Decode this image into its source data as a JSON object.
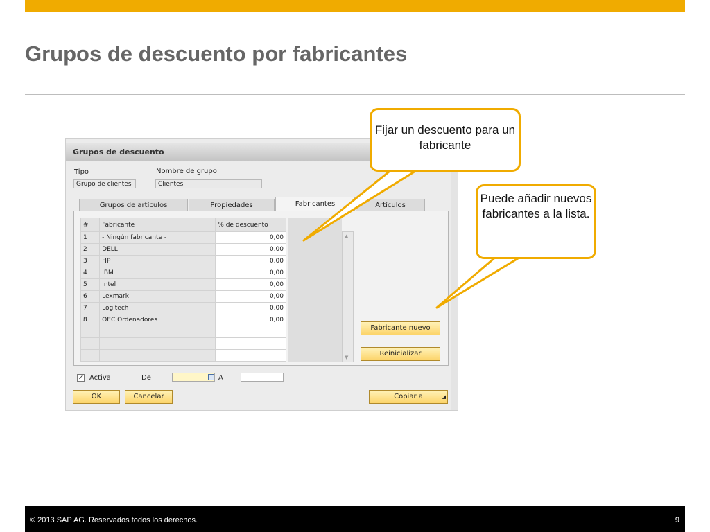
{
  "slide": {
    "title": "Grupos de descuento por fabricantes",
    "footer_copyright": "©  2013 SAP AG. Reservados todos los derechos.",
    "page_number": "9",
    "accent_color": "#f0ab00"
  },
  "window": {
    "title": "Grupos de descuento",
    "tipo_label": "Tipo",
    "tipo_value": "Grupo de clientes",
    "nombre_label": "Nombre de grupo",
    "nombre_value": "Clientes",
    "tabs": [
      "Grupos de artículos",
      "Propiedades",
      "Fabricantes",
      "Artículos"
    ],
    "active_tab": "Fabricantes",
    "grid": {
      "headers": [
        "#",
        "Fabricante",
        "% de descuento"
      ],
      "rows": [
        {
          "n": "1",
          "fabricante": "- Ningún fabricante -",
          "descuento": "0,00"
        },
        {
          "n": "2",
          "fabricante": "DELL",
          "descuento": "0,00"
        },
        {
          "n": "3",
          "fabricante": "HP",
          "descuento": "0,00"
        },
        {
          "n": "4",
          "fabricante": "IBM",
          "descuento": "0,00"
        },
        {
          "n": "5",
          "fabricante": "Intel",
          "descuento": "0,00"
        },
        {
          "n": "6",
          "fabricante": "Lexmark",
          "descuento": "0,00"
        },
        {
          "n": "7",
          "fabricante": "Logitech",
          "descuento": "0,00"
        },
        {
          "n": "8",
          "fabricante": "OEC Ordenadores",
          "descuento": "0,00"
        }
      ]
    },
    "btn_fabricante_nuevo": "Fabricante nuevo",
    "btn_reinicializar": "Reinicializar",
    "activa_label": "Activa",
    "activa_checked": true,
    "de_label": "De",
    "a_label": "A",
    "btn_ok": "OK",
    "btn_cancelar": "Cancelar",
    "btn_copiar": "Copiar a"
  },
  "callouts": {
    "c1": "Fijar un descuento para un fabricante",
    "c2": "Puede añadir nuevos fabricantes a la lista."
  }
}
